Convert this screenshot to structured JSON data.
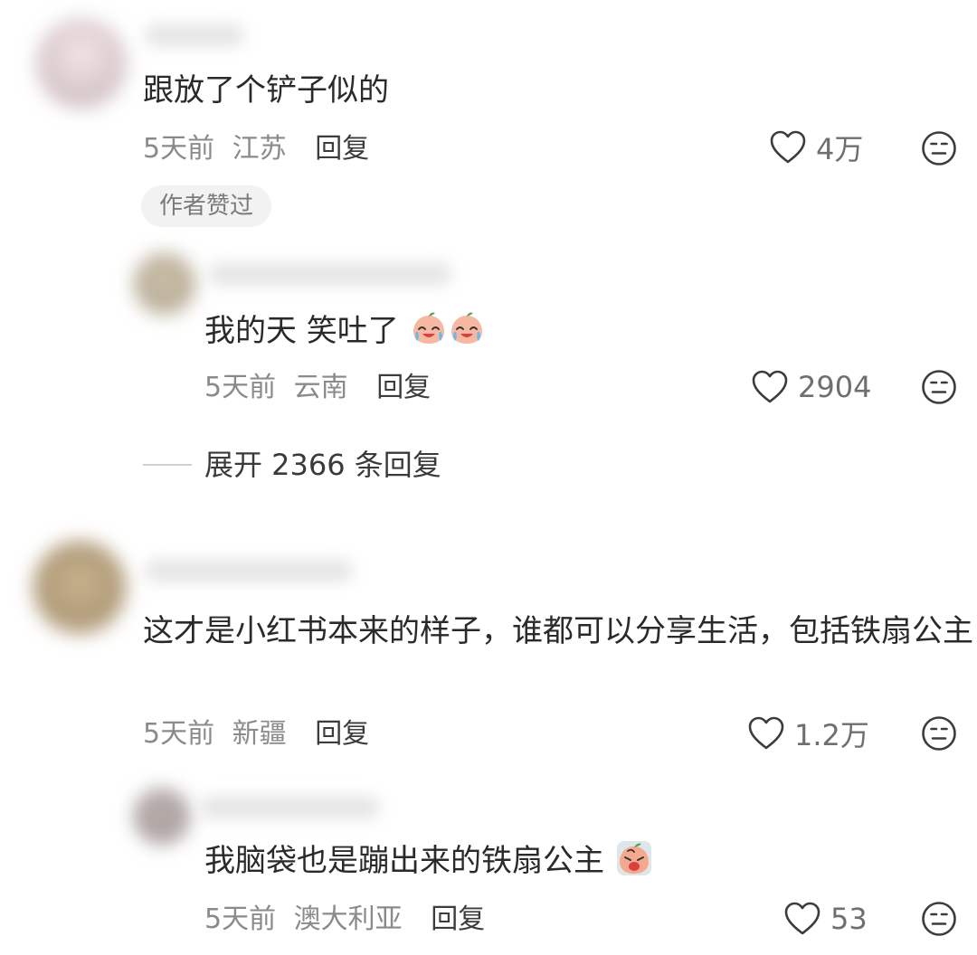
{
  "comments": [
    {
      "text": "跟放了个铲子似的",
      "time": "5天前",
      "location": "江苏",
      "reply_label": "回复",
      "likes": "4万",
      "badge": "作者赞过",
      "replies": [
        {
          "text": "我的天 笑吐了",
          "emoji": [
            "laughing-crying-peach-emoji",
            "laughing-crying-peach-emoji"
          ],
          "time": "5天前",
          "location": "云南",
          "reply_label": "回复",
          "likes": "2904"
        }
      ],
      "expand_label": "展开 2366 条回复"
    },
    {
      "text": "这才是小红书本来的样子，谁都可以分享生活，包括铁扇公主",
      "time": "5天前",
      "location": "新疆",
      "reply_label": "回复",
      "likes": "1.2万",
      "replies": [
        {
          "text": "我脑袋也是蹦出来的铁扇公主",
          "emoji": [
            "crying-peach-emoji"
          ],
          "time": "5天前",
          "location": "澳大利亚",
          "reply_label": "回复",
          "likes": "53"
        }
      ]
    }
  ],
  "icons": {
    "like": "heart-outline-icon",
    "dislike": "neutral-face-icon"
  },
  "colors": {
    "text_primary": "#2a2a2a",
    "text_meta": "#8a8a8a",
    "badge_bg": "#f2f2f2"
  }
}
